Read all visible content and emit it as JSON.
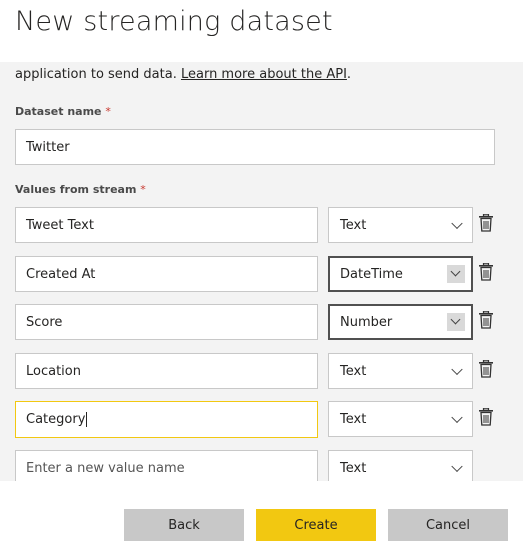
{
  "dialog": {
    "title": "New streaming dataset",
    "intro_text": "application to send data. ",
    "intro_link": "Learn more about the API",
    "intro_end": "."
  },
  "dataset": {
    "label": "Dataset name",
    "required_mark": "*",
    "value": "Twitter"
  },
  "values": {
    "label": "Values from stream",
    "required_mark": "*",
    "rows": [
      {
        "name": "Tweet Text",
        "type": "Text"
      },
      {
        "name": "Created At",
        "type": "DateTime"
      },
      {
        "name": "Score",
        "type": "Number"
      },
      {
        "name": "Location",
        "type": "Text"
      },
      {
        "name": "Category",
        "type": "Text"
      }
    ],
    "new_row": {
      "placeholder": "Enter a new value name",
      "type": "Text"
    }
  },
  "footer": {
    "back_label": "Back",
    "create_label": "Create",
    "cancel_label": "Cancel"
  },
  "colors": {
    "accent": "#f2c811",
    "required": "#c8382f",
    "panel_bg": "#f3f3f3"
  }
}
